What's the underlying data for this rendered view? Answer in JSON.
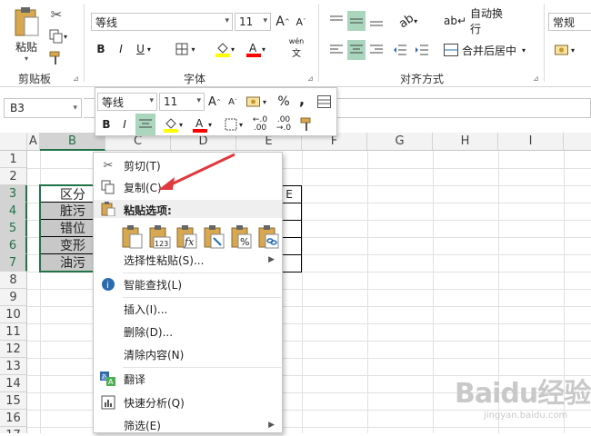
{
  "ribbon": {
    "paste_label": "粘贴",
    "clipboard_group": "剪贴板",
    "font_group": "字体",
    "alignment_group": "对齐方式",
    "font_name": "等线",
    "font_size": "11",
    "bold": "B",
    "italic": "I",
    "underline": "U",
    "wrap_text": "自动换行",
    "merge_center": "合并后居中",
    "number_format": "常规",
    "phonetic": "wén",
    "grow_font": "A",
    "shrink_font": "A"
  },
  "formula_bar": {
    "name_box": "B3",
    "value": ""
  },
  "sheet": {
    "columns": [
      "A",
      "B",
      "C",
      "D",
      "E",
      "F",
      "G",
      "H",
      "I"
    ],
    "rows": [
      "1",
      "2",
      "3",
      "4",
      "5",
      "6",
      "7",
      "8",
      "9",
      "10",
      "11",
      "12",
      "13",
      "14",
      "15",
      "16",
      "17"
    ],
    "selected_col": "B",
    "cells_b": [
      "区分",
      "脏污",
      "错位",
      "变形",
      "油污"
    ],
    "cell_e3_partial": "E"
  },
  "mini_toolbar": {
    "font_name": "等线",
    "font_size": "11",
    "percent": "%",
    "comma": ",",
    "bold": "B",
    "italic": "I"
  },
  "context_menu": {
    "cut": "剪切(T)",
    "copy": "复制(C)",
    "paste_options": "粘贴选项:",
    "paste_special": "选择性粘贴(S)...",
    "smart_lookup": "智能查找(L)",
    "insert": "插入(I)...",
    "delete": "删除(D)...",
    "clear_contents": "清除内容(N)",
    "translate": "翻译",
    "quick_analysis": "快速分析(Q)",
    "filter": "筛选(E)"
  },
  "watermark": {
    "text": "Baidu经验",
    "url": "jingyan.baidu.com"
  },
  "colors": {
    "accent": "#217346",
    "arrow": "#e0393e",
    "highlight": "#ffff00",
    "font_red": "#ff0000"
  }
}
